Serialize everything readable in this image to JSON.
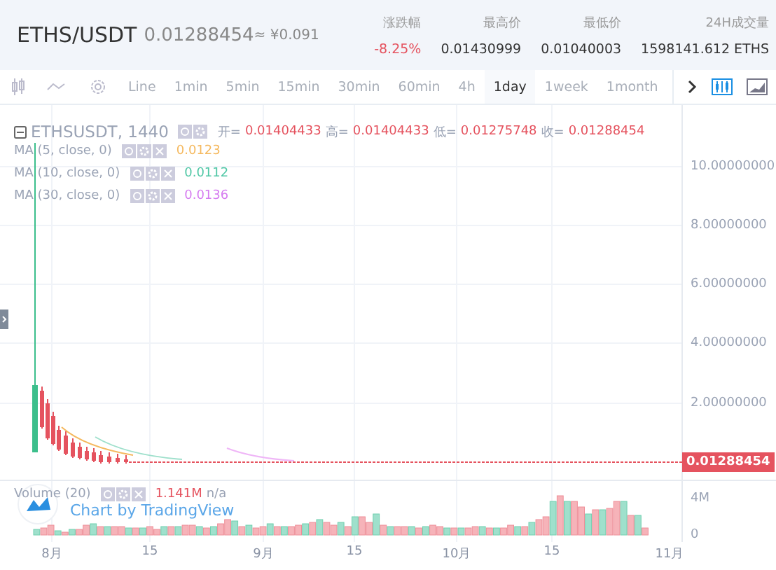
{
  "header": {
    "pair": "ETHS/USDT",
    "price": "0.01288454",
    "approx": "≈ ¥0.091",
    "stats": [
      {
        "label": "涨跌幅",
        "value": "-8.25%",
        "kind": "down"
      },
      {
        "label": "最高价",
        "value": "0.01430999",
        "kind": "plain"
      },
      {
        "label": "最低价",
        "value": "0.01040003",
        "kind": "plain"
      },
      {
        "label": "24H成交量",
        "value": "1598141.612 ETHS",
        "kind": "plain"
      }
    ]
  },
  "toolbar": {
    "intervals": [
      {
        "label": "Line",
        "selected": false
      },
      {
        "label": "1min",
        "selected": false
      },
      {
        "label": "5min",
        "selected": false
      },
      {
        "label": "15min",
        "selected": false
      },
      {
        "label": "30min",
        "selected": false
      },
      {
        "label": "60min",
        "selected": false
      },
      {
        "label": "4h",
        "selected": false
      },
      {
        "label": "1day",
        "selected": true
      },
      {
        "label": "1week",
        "selected": false
      },
      {
        "label": "1month",
        "selected": false
      }
    ],
    "styles": [
      {
        "kind": "candles",
        "selected": true
      },
      {
        "kind": "area",
        "selected": false
      }
    ]
  },
  "legend": {
    "symbol": "ETHSUSDT, 1440",
    "ohlc": [
      {
        "key": "开=",
        "value": "0.01404433"
      },
      {
        "key": "高=",
        "value": "0.01404433"
      },
      {
        "key": "低=",
        "value": "0.01275748"
      },
      {
        "key": "收=",
        "value": "0.01288454"
      }
    ],
    "studies": [
      {
        "name": "MA (5, close, 0)",
        "value": "0.0123",
        "color": "#f5b95f"
      },
      {
        "name": "MA (10, close, 0)",
        "value": "0.0112",
        "color": "#4fc7a5"
      },
      {
        "name": "MA (30, close, 0)",
        "value": "0.0136",
        "color": "#d67cf0"
      }
    ]
  },
  "price_axis": {
    "ticks": [
      "10.00000000",
      "8.00000000",
      "6.00000000",
      "4.00000000",
      "2.00000000"
    ],
    "last_price": "0.01288454"
  },
  "volume": {
    "name": "Volume (20)",
    "value": "1.141M",
    "extra": "n/a",
    "ticks": [
      "4M",
      "0"
    ]
  },
  "time_axis": [
    "8月",
    "15",
    "9月",
    "15",
    "10月",
    "15",
    "11月"
  ],
  "attribution": "Chart by TradingView"
}
